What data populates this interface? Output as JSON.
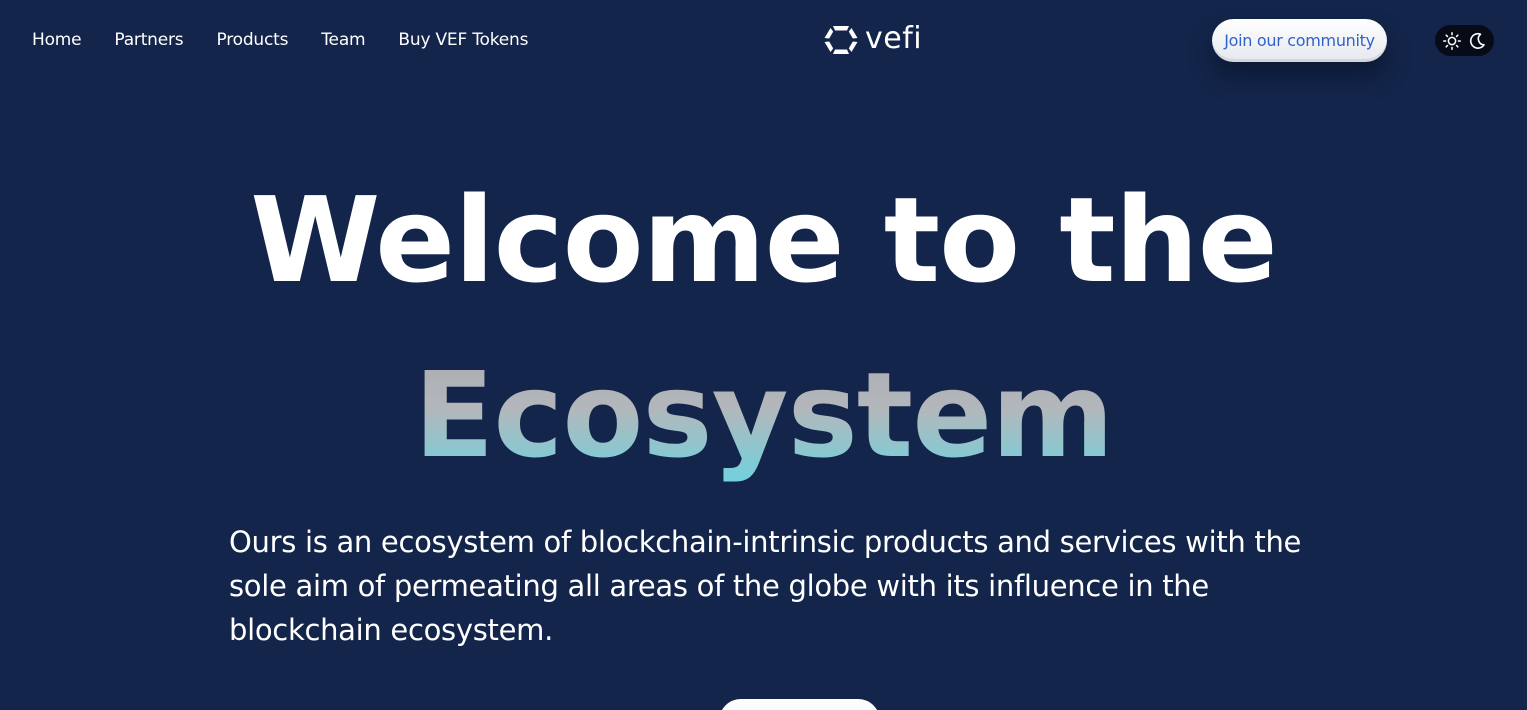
{
  "nav": {
    "items": [
      {
        "label": "Home"
      },
      {
        "label": "Partners"
      },
      {
        "label": "Products"
      },
      {
        "label": "Team"
      },
      {
        "label": "Buy VEF Tokens"
      }
    ]
  },
  "brand": {
    "name": "vefi",
    "logo_icon": "hexagon-ring-icon"
  },
  "header": {
    "community_button_label": "Join our community",
    "theme_toggle": {
      "light_icon": "sun-icon",
      "dark_icon": "moon-icon",
      "active": "dark"
    }
  },
  "hero": {
    "title_line1": "Welcome to the",
    "title_line2": "Ecosystem",
    "description": "Ours is an ecosystem of blockchain-intrinsic products and services with the sole aim of permeating all areas of the globe with its influence in the blockchain ecosystem."
  },
  "colors": {
    "background": "#13254a",
    "button_text": "#2f63c9",
    "gradient_accent": "#6fd3df"
  }
}
